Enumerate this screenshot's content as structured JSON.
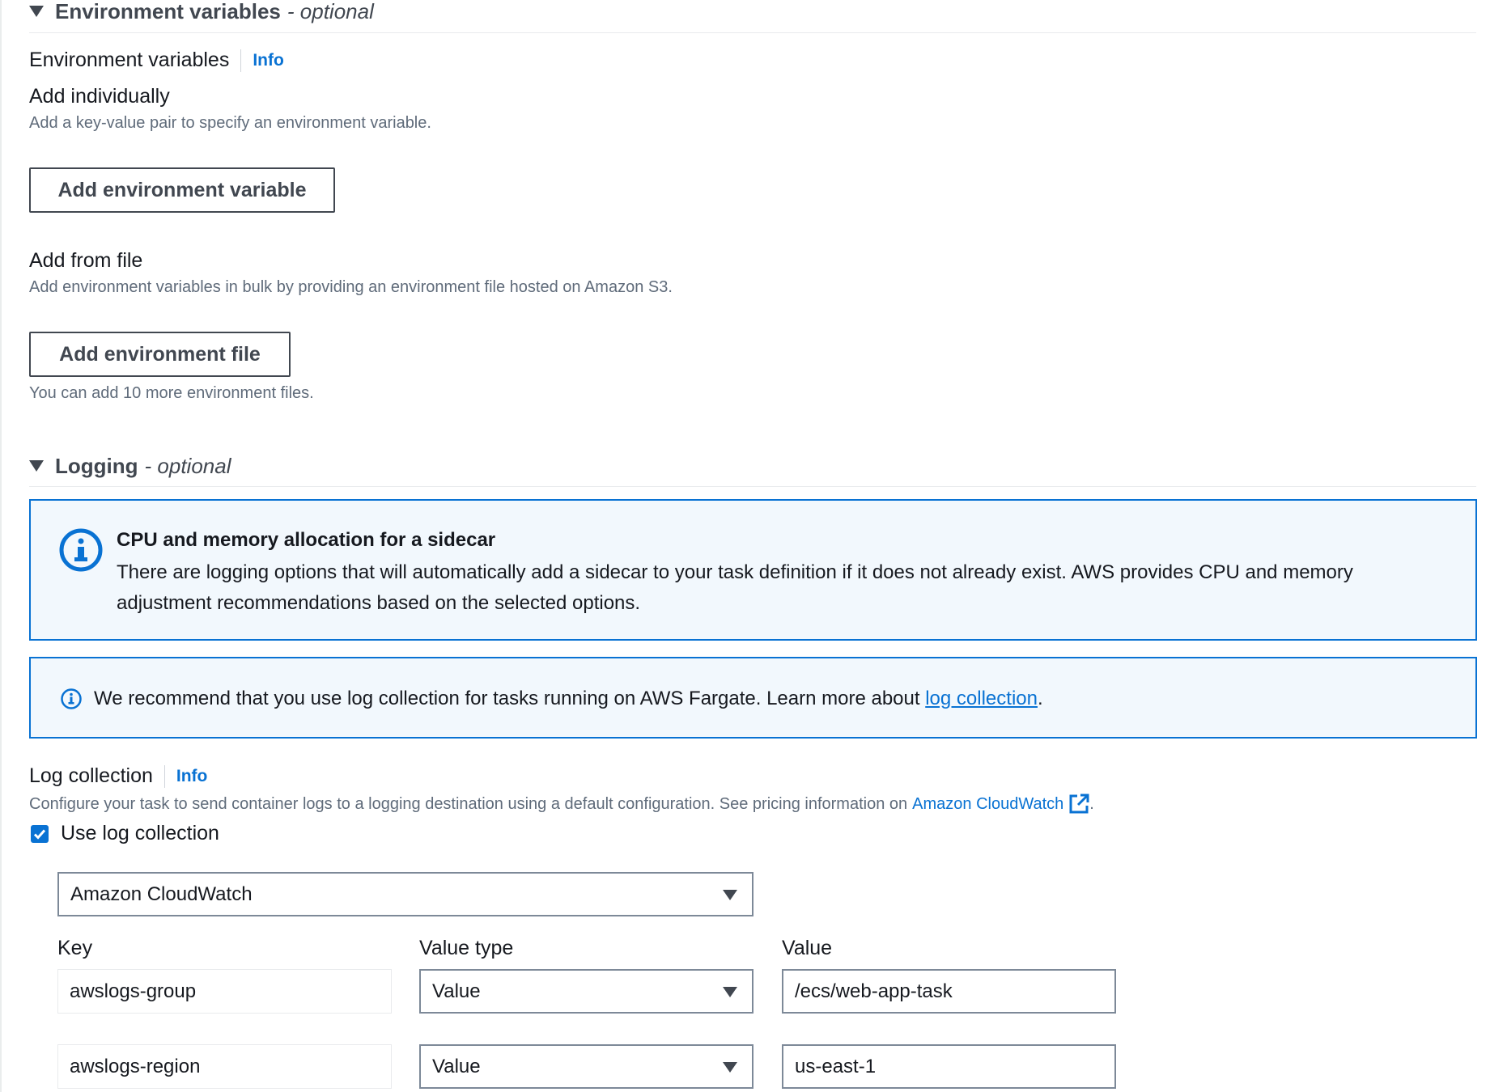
{
  "env_section": {
    "title": "Environment variables",
    "optional": "- optional",
    "label": "Environment variables",
    "info": "Info",
    "add_individually": {
      "title": "Add individually",
      "desc": "Add a key-value pair to specify an environment variable.",
      "button": "Add environment variable"
    },
    "add_from_file": {
      "title": "Add from file",
      "desc": "Add environment variables in bulk by providing an environment file hosted on Amazon S3.",
      "button": "Add environment file",
      "hint": "You can add 10 more environment files."
    }
  },
  "logging_section": {
    "title": "Logging",
    "optional": "- optional",
    "alert_sidecar": {
      "title": "CPU and memory allocation for a sidecar",
      "text": "There are logging options that will automatically add a sidecar to your task definition if it does not already exist. AWS provides CPU and memory adjustment recommendations based on the selected options."
    },
    "alert_fargate": {
      "text": "We recommend that you use log collection for tasks running on AWS Fargate. Learn more about ",
      "link": "log collection",
      "suffix": "."
    },
    "log_collection": {
      "label": "Log collection",
      "info": "Info",
      "desc": "Configure your task to send container logs to a logging destination using a default configuration. See pricing information on ",
      "desc_link": "Amazon CloudWatch",
      "desc_suffix": ".",
      "checkbox_label": "Use log collection",
      "checked": true,
      "destination": "Amazon CloudWatch"
    },
    "options_table": {
      "headers": {
        "key": "Key",
        "value_type": "Value type",
        "value": "Value"
      },
      "rows": [
        {
          "key": "awslogs-group",
          "value_type": "Value",
          "value": "/ecs/web-app-task"
        },
        {
          "key": "awslogs-region",
          "value_type": "Value",
          "value": "us-east-1"
        }
      ]
    }
  },
  "colors": {
    "accent": "#0972d3",
    "alert_bg": "#f2f8fd",
    "text": "#16191f",
    "muted": "#5f6b7a"
  }
}
